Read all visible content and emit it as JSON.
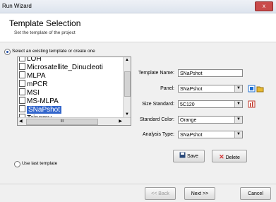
{
  "window": {
    "title": "Run Wizard",
    "close_glyph": "x"
  },
  "header": {
    "title": "Template Selection",
    "subtitle": "Set the template of the project"
  },
  "options": {
    "select_existing_label": "Select an existing template or create one",
    "use_last_label": "Use last template"
  },
  "templates": {
    "items": [
      "LOH",
      "Microsatellite_Dinucleoti",
      "MLPA",
      "mPCR",
      "MSI",
      "MS-MLPA",
      "SNaPshot",
      "Trisomy"
    ],
    "selected": "SNaPshot",
    "hscroll_text": "III"
  },
  "form": {
    "template_name_label": "Template Name:",
    "template_name_value": "SNaPshot",
    "panel_label": "Panel:",
    "panel_value": "SNaPshot",
    "size_standard_label": "Size Standard:",
    "size_standard_value": "5C120",
    "standard_color_label": "Standard Color:",
    "standard_color_value": "Orange",
    "analysis_type_label": "Analysis Type:",
    "analysis_type_value": "SNaPshot"
  },
  "actions": {
    "save_label": "Save",
    "delete_label": "Delete"
  },
  "nav": {
    "back_label": "<< Back",
    "next_label": "Next >>",
    "cancel_label": "Cancel"
  },
  "colors": {
    "accent": "#3366cc",
    "delete_red": "#d32f2f",
    "close_red": "#c94b4b"
  }
}
